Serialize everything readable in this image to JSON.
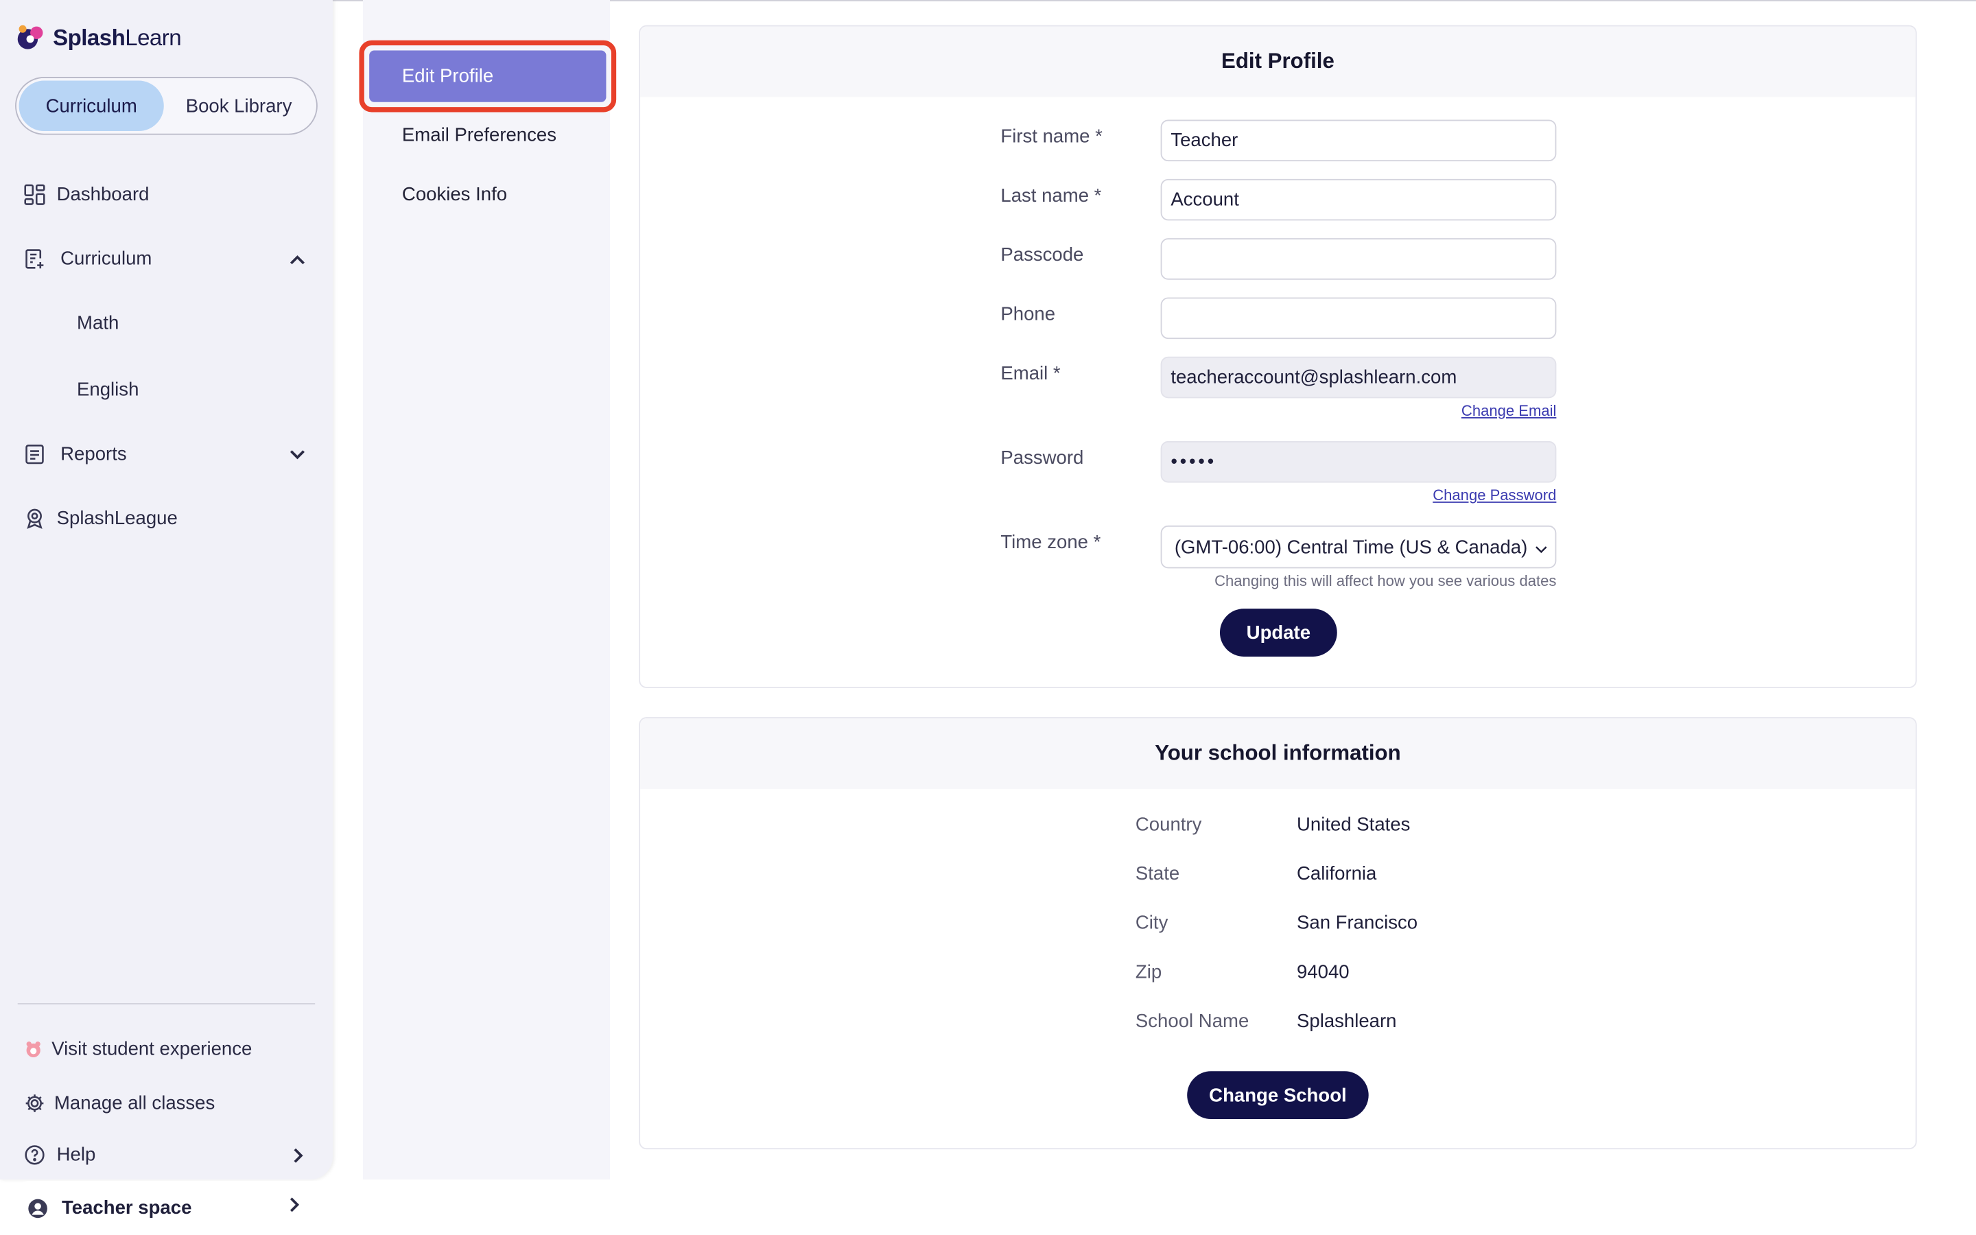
{
  "brand": {
    "name_bold": "Splash",
    "name_light": "Learn"
  },
  "toggle": {
    "curriculum": "Curriculum",
    "book_library": "Book Library"
  },
  "nav": {
    "dashboard": "Dashboard",
    "curriculum": "Curriculum",
    "math": "Math",
    "english": "English",
    "reports": "Reports",
    "splashleague": "SplashLeague",
    "visit_student": "Visit student experience",
    "manage_classes": "Manage all classes",
    "help": "Help",
    "teacher_space": "Teacher space"
  },
  "settings_menu": {
    "edit_profile": "Edit Profile",
    "email_preferences": "Email Preferences",
    "cookies_info": "Cookies Info"
  },
  "edit_profile": {
    "title": "Edit Profile",
    "first_name_label": "First name *",
    "first_name_value": "Teacher",
    "last_name_label": "Last name *",
    "last_name_value": "Account",
    "passcode_label": "Passcode",
    "passcode_value": "",
    "phone_label": "Phone",
    "phone_value": "",
    "email_label": "Email *",
    "email_value": "teacheraccount@splashlearn.com",
    "change_email": "Change Email",
    "password_label": "Password",
    "password_value": "•••••",
    "change_password": "Change Password",
    "timezone_label": "Time zone *",
    "timezone_value": "(GMT-06:00) Central Time (US & Canada)",
    "timezone_hint": "Changing this will affect how you see various dates",
    "update_button": "Update"
  },
  "school": {
    "title": "Your school information",
    "country_label": "Country",
    "country_value": "United States",
    "state_label": "State",
    "state_value": "California",
    "city_label": "City",
    "city_value": "San Francisco",
    "zip_label": "Zip",
    "zip_value": "94040",
    "school_name_label": "School Name",
    "school_name_value": "Splashlearn",
    "change_school_button": "Change School"
  },
  "colors": {
    "accent": "#7a7ad6",
    "highlight_border": "#e8402a",
    "primary_button": "#12124a",
    "toggle_active": "#b8d5f5"
  }
}
